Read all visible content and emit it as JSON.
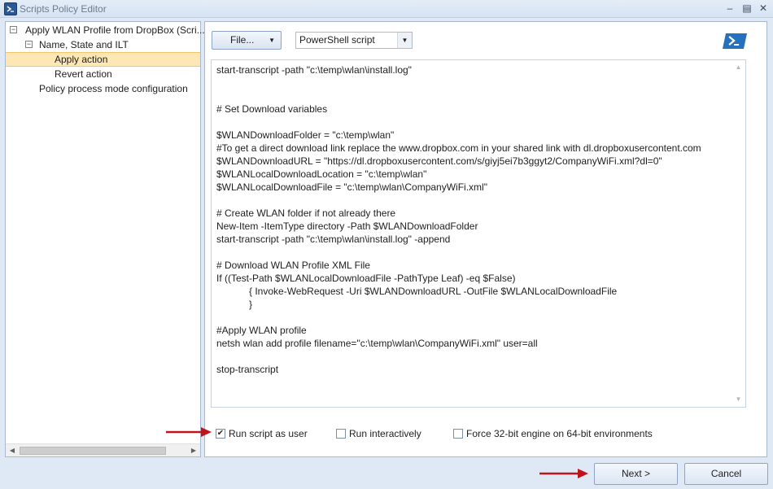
{
  "window": {
    "title": "Scripts Policy Editor"
  },
  "tree": {
    "items": [
      {
        "label": "Apply WLAN Profile from DropBox (Scri...",
        "expander": "⊟"
      },
      {
        "label": "Name, State and ILT",
        "expander": "⊟"
      },
      {
        "label": "Apply action",
        "selected": true
      },
      {
        "label": "Revert action"
      },
      {
        "label": "Policy process mode configuration"
      }
    ]
  },
  "toolbar": {
    "file_label": "File...",
    "script_type": "PowerShell script"
  },
  "editor": {
    "lines": [
      "start-transcript -path \"c:\\temp\\wlan\\install.log\"",
      "",
      "",
      "# Set Download variables",
      "",
      "$WLANDownloadFolder = \"c:\\temp\\wlan\"",
      "#To get a direct download link replace the www.dropbox.com in your shared link with dl.dropboxusercontent.com",
      "$WLANDownloadURL = \"https://dl.dropboxusercontent.com/s/giyj5ei7b3ggyt2/CompanyWiFi.xml?dl=0\"",
      "$WLANLocalDownloadLocation = \"c:\\temp\\wlan\"",
      "$WLANLocalDownloadFile = \"c:\\temp\\wlan\\CompanyWiFi.xml\"",
      "",
      "# Create WLAN folder if not already there",
      "New-Item -ItemType directory -Path $WLANDownloadFolder",
      "start-transcript -path \"c:\\temp\\wlan\\install.log\" -append",
      "",
      "# Download WLAN Profile XML File",
      "If ((Test-Path $WLANLocalDownloadFile -PathType Leaf) -eq $False)",
      "            { Invoke-WebRequest -Uri $WLANDownloadURL -OutFile $WLANLocalDownloadFile",
      "            }",
      "",
      "#Apply WLAN profile",
      "netsh wlan add profile filename=\"c:\\temp\\wlan\\CompanyWiFi.xml\" user=all",
      "",
      "stop-transcript"
    ]
  },
  "options": {
    "run_as_user": {
      "label": "Run script as user",
      "checked": true
    },
    "run_interactively": {
      "label": "Run interactively",
      "checked": false
    },
    "force_32bit": {
      "label": "Force 32-bit engine on 64-bit environments",
      "checked": false
    }
  },
  "buttons": {
    "next": "Next >",
    "cancel": "Cancel"
  },
  "colors": {
    "annotation_arrow": "#c0141b",
    "selected_row": "#fde7b4",
    "powershell_blue": "#2671be"
  }
}
